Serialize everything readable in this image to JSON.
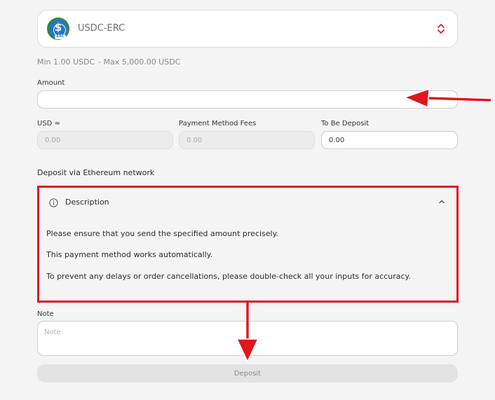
{
  "selector": {
    "currency": "USDC-ERC",
    "icon": "usdc-coin-icon",
    "coin_tag": "ERC",
    "chevron_icon": "chevron-up-down-icon"
  },
  "limits": {
    "min": "Min 1.00 USDC",
    "max": "- Max 5,000.00 USDC"
  },
  "amount": {
    "label": "Amount",
    "value": ""
  },
  "usd": {
    "label": "USD ≈",
    "value": "0.00"
  },
  "fees": {
    "label": "Payment Method Fees",
    "value": "0.00"
  },
  "to_deposit": {
    "label": "To Be Deposit",
    "value": "0.00"
  },
  "network_text": "Deposit via Ethereum network",
  "description": {
    "title": "Description",
    "info_icon": "info-circle-icon",
    "collapse_icon": "chevron-up-icon",
    "lines": [
      "Please ensure that you send the specified amount precisely.",
      "This payment method works automatically.",
      "To prevent any delays or order cancellations, please double-check all your inputs for accuracy."
    ]
  },
  "note": {
    "label": "Note",
    "placeholder": "Note"
  },
  "deposit_label": "Deposit",
  "annotation_color": "#e0161d"
}
